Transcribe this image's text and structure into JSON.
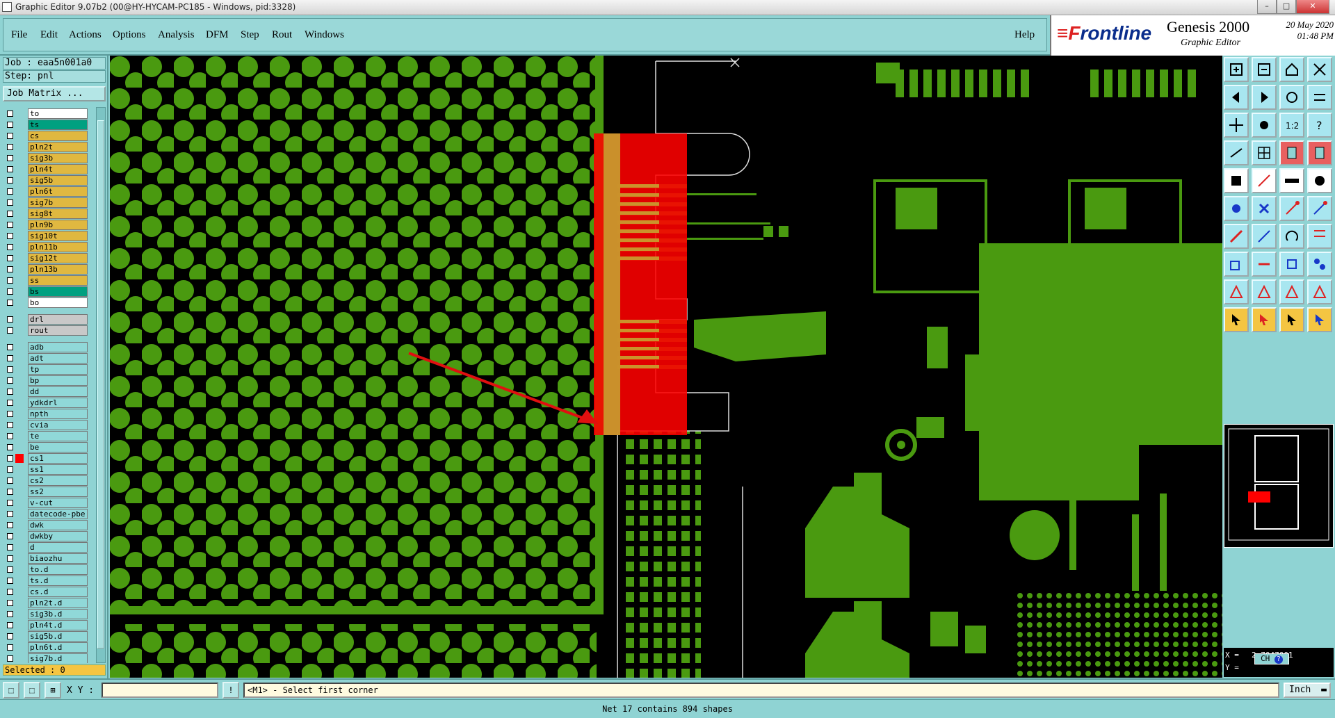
{
  "window": {
    "title": "Graphic Editor 9.07b2 (00@HY-HYCAM-PC185 - Windows, pid:3328)",
    "min": "–",
    "max": "□",
    "close": "✕"
  },
  "menu": {
    "items": [
      "File",
      "Edit",
      "Actions",
      "Options",
      "Analysis",
      "DFM",
      "Step",
      "Rout",
      "Windows"
    ],
    "help": "Help"
  },
  "brand": {
    "logo_f": "F",
    "logo_rest": "rontline",
    "product": "Genesis 2000",
    "subtitle": "Graphic Editor",
    "date": "20 May 2020",
    "time": "01:48 PM"
  },
  "job": {
    "job_line": "Job : eaa5n001a0",
    "step_line": "Step: pnl",
    "matrix_button": "Job Matrix ..."
  },
  "colors": {
    "board": "#4a9a10",
    "layer_yellow": "#e0b840",
    "layer_teal": "#00a080",
    "layer_white": "#ffffff",
    "layer_gray": "#c8c8c8",
    "layer_cyan": "#90d8d8",
    "highlight_red": "#ff0000",
    "arrow_red": "#e01010"
  },
  "layers": [
    {
      "name": "to",
      "color": "white"
    },
    {
      "name": "ts",
      "color": "teal"
    },
    {
      "name": "cs",
      "color": "yellow"
    },
    {
      "name": "pln2t",
      "color": "yellow"
    },
    {
      "name": "sig3b",
      "color": "yellow"
    },
    {
      "name": "pln4t",
      "color": "yellow"
    },
    {
      "name": "sig5b",
      "color": "yellow"
    },
    {
      "name": "pln6t",
      "color": "yellow"
    },
    {
      "name": "sig7b",
      "color": "yellow"
    },
    {
      "name": "sig8t",
      "color": "yellow"
    },
    {
      "name": "pln9b",
      "color": "yellow"
    },
    {
      "name": "sig10t",
      "color": "yellow"
    },
    {
      "name": "pln11b",
      "color": "yellow"
    },
    {
      "name": "sig12t",
      "color": "yellow"
    },
    {
      "name": "pln13b",
      "color": "yellow"
    },
    {
      "name": "ss",
      "color": "yellow"
    },
    {
      "name": "bs",
      "color": "teal"
    },
    {
      "name": "bo",
      "color": "white"
    },
    {
      "name": "drl",
      "color": "gray",
      "gap": true
    },
    {
      "name": "rout",
      "color": "gray"
    },
    {
      "name": "adb",
      "color": "cyan",
      "gap": true
    },
    {
      "name": "adt",
      "color": "cyan"
    },
    {
      "name": "tp",
      "color": "cyan"
    },
    {
      "name": "bp",
      "color": "cyan"
    },
    {
      "name": "dd",
      "color": "cyan"
    },
    {
      "name": "ydkdrl",
      "color": "cyan"
    },
    {
      "name": "npth",
      "color": "cyan"
    },
    {
      "name": "cvia",
      "color": "cyan"
    },
    {
      "name": "te",
      "color": "cyan"
    },
    {
      "name": "be",
      "color": "cyan"
    },
    {
      "name": "cs1",
      "color": "cyan",
      "active": true
    },
    {
      "name": "ss1",
      "color": "cyan"
    },
    {
      "name": "cs2",
      "color": "cyan"
    },
    {
      "name": "ss2",
      "color": "cyan"
    },
    {
      "name": "v-cut",
      "color": "cyan"
    },
    {
      "name": "datecode-pbe",
      "color": "cyan"
    },
    {
      "name": "dwk",
      "color": "cyan"
    },
    {
      "name": "dwkby",
      "color": "cyan"
    },
    {
      "name": "d",
      "color": "cyan"
    },
    {
      "name": "biaozhu",
      "color": "cyan"
    },
    {
      "name": "to.d",
      "color": "cyan"
    },
    {
      "name": "ts.d",
      "color": "cyan"
    },
    {
      "name": "cs.d",
      "color": "cyan"
    },
    {
      "name": "pln2t.d",
      "color": "cyan"
    },
    {
      "name": "sig3b.d",
      "color": "cyan"
    },
    {
      "name": "pln4t.d",
      "color": "cyan"
    },
    {
      "name": "sig5b.d",
      "color": "cyan"
    },
    {
      "name": "pln6t.d",
      "color": "cyan"
    },
    {
      "name": "sig7b.d",
      "color": "cyan"
    }
  ],
  "selected": "Selected : 0",
  "status": {
    "xy_label": "X Y :",
    "xy_value": "",
    "prompt": "<M1> - Select first corner",
    "unit": "Inch",
    "net_message": "Net 17 contains 894 shapes"
  },
  "coords": {
    "x_label": "X =",
    "y_label": "Y =",
    "x_value": "2.7047001",
    "ch_label": "CH"
  }
}
